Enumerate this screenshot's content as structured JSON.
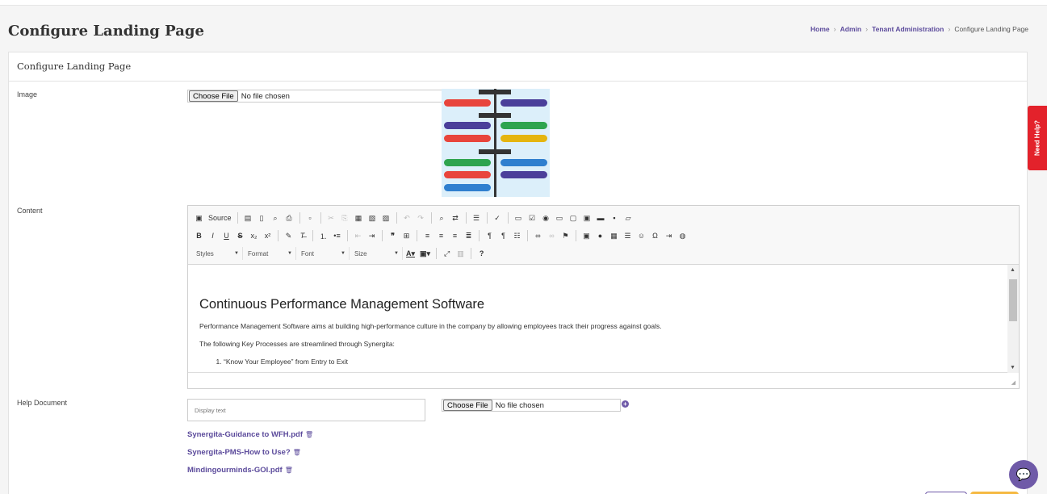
{
  "page": {
    "title": "Configure Landing Page"
  },
  "breadcrumb": [
    {
      "label": "Home",
      "link": true
    },
    {
      "label": "Admin",
      "link": true
    },
    {
      "label": "Tenant Administration",
      "link": true
    },
    {
      "label": "Configure Landing Page",
      "link": false
    }
  ],
  "card": {
    "title": "Configure Landing Page"
  },
  "image_field": {
    "label": "Image",
    "button": "Choose File",
    "status": "No file chosen"
  },
  "content_field": {
    "label": "Content"
  },
  "toolbar": {
    "source_label": "Source",
    "combos": {
      "styles": "Styles",
      "format": "Format",
      "font": "Font",
      "size": "Size"
    }
  },
  "editor": {
    "heading": "Continuous Performance Management Software",
    "para1": "Performance Management Software aims at building high-performance culture in the company by allowing employees track their progress against goals.",
    "para2": "The following Key Processes are streamlined through Synergita:",
    "list": [
      "“Know Your Employee” from Entry to Exit"
    ]
  },
  "help_doc": {
    "label": "Help Document",
    "placeholder": "Display text",
    "button": "Choose File",
    "status": "No file chosen",
    "files": [
      "Synergita-Guidance to WFH.pdf",
      "Synergita-PMS-How to Use?",
      "Mindingourminds-GOI.pdf"
    ]
  },
  "need_help": {
    "label": "Need Help?"
  },
  "colors": {
    "accent": "#5b4a9b",
    "help_tab": "#e3222b",
    "chat": "#6f5aa8"
  }
}
